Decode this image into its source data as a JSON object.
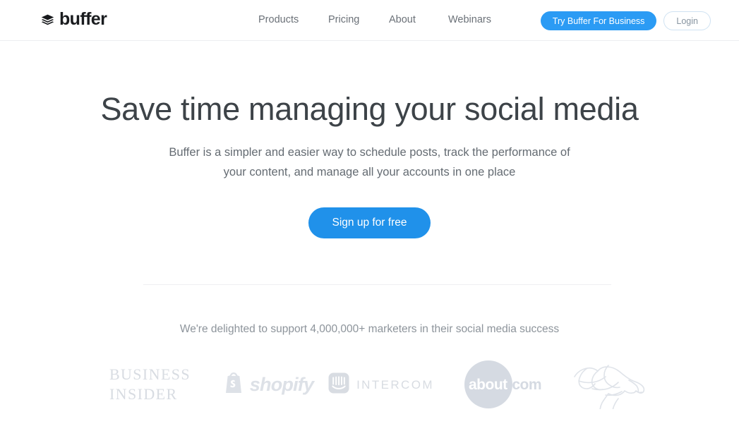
{
  "header": {
    "logo": {
      "icon": "layers-stack-icon",
      "text": "buffer"
    },
    "nav": [
      {
        "label": "Products"
      },
      {
        "label": "Pricing"
      },
      {
        "label": "About"
      },
      {
        "label": "Webinars"
      }
    ],
    "business_cta_label": "Try Buffer For Business",
    "login_label": "Login"
  },
  "hero": {
    "title": "Save time managing your social media",
    "subtitle": "Buffer is a simpler and easier way to schedule posts, track the performance of your content, and manage all your accounts in one place",
    "cta_label": "Sign up for free"
  },
  "social_proof": {
    "text": "We're delighted to support 4,000,000+ marketers in their social media success",
    "logos": [
      {
        "name": "business-insider",
        "line1": "BUSINESS",
        "line2": "INSIDER"
      },
      {
        "name": "shopify",
        "wordmark": "shopify",
        "icon": "shopping-bag-icon"
      },
      {
        "name": "intercom",
        "wordmark": "INTERCOM",
        "icon": "intercom-square-icon"
      },
      {
        "name": "about-com",
        "word": "about",
        "suffix": ".com"
      },
      {
        "name": "denver-broncos",
        "icon": "bronco-horse-head-icon"
      }
    ]
  },
  "colors": {
    "accent_blue": "#2091ea",
    "header_blue": "#2b9bf4",
    "title_gray": "#3d4348",
    "body_gray": "#646b72",
    "muted_gray": "#8d949b",
    "logo_gray": "#d8dce2",
    "border": "#eceef0",
    "background": "#ffffff"
  }
}
